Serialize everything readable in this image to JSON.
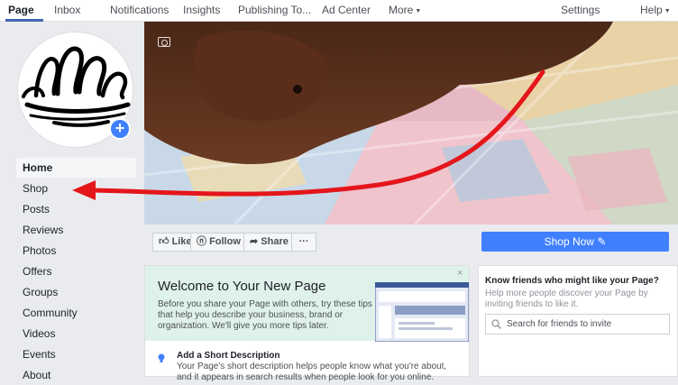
{
  "topnav": {
    "tabs": [
      "Page",
      "Inbox",
      "Notifications",
      "Insights",
      "Publishing To...",
      "Ad Center",
      "More"
    ],
    "settings": "Settings",
    "help": "Help"
  },
  "sidebar": {
    "items": [
      "Home",
      "Shop",
      "Posts",
      "Reviews",
      "Photos",
      "Offers",
      "Groups",
      "Community",
      "Videos",
      "Events",
      "About"
    ]
  },
  "actions": {
    "like": "Like",
    "follow": "Follow",
    "share": "Share",
    "more": "···",
    "shop_now": "Shop Now"
  },
  "welcome": {
    "title": "Welcome to Your New Page",
    "text": "Before you share your Page with others, try these tips that help you describe your business, brand or organization. We'll give you more tips later.",
    "close": "×",
    "short_desc_title": "Add a Short Description",
    "short_desc_text": "Your Page's short description helps people know what you're about, and it appears in search results when people look for you online."
  },
  "friends": {
    "title": "Know friends who might like your Page?",
    "text": "Help more people discover your Page by inviting friends to like it.",
    "search_placeholder": "Search for friends to invite"
  },
  "colors": {
    "brand_blue": "#4267b2",
    "button_blue": "#4080ff",
    "annotation_arrow": "#e4161b"
  }
}
